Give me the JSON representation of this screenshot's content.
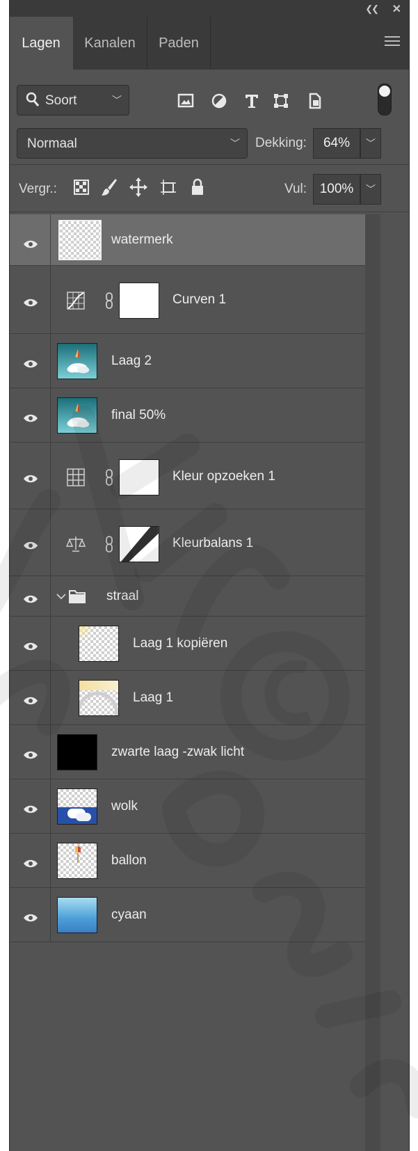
{
  "panel": {
    "tabs": [
      {
        "label": "Lagen",
        "active": true
      },
      {
        "label": "Kanalen",
        "active": false
      },
      {
        "label": "Paden",
        "active": false
      }
    ],
    "filter": {
      "label": "Soort"
    },
    "blend_mode": "Normaal",
    "opacity_label": "Dekking:",
    "opacity_value": "64%",
    "lock_label": "Vergr.:",
    "fill_label": "Vul:",
    "fill_value": "100%"
  },
  "layers": [
    {
      "name": "watermerk",
      "kind": "pixel",
      "selected": true
    },
    {
      "name": "Curven 1",
      "kind": "adjustment",
      "adjustment_icon": "curves-icon"
    },
    {
      "name": "Laag 2",
      "kind": "pixel"
    },
    {
      "name": "final  50%",
      "kind": "pixel"
    },
    {
      "name": "Kleur opzoeken 1",
      "kind": "adjustment",
      "adjustment_icon": "color-lookup-icon"
    },
    {
      "name": "Kleurbalans 1",
      "kind": "adjustment",
      "adjustment_icon": "color-balance-icon"
    },
    {
      "name": "straal",
      "kind": "group",
      "expanded": true
    },
    {
      "name": "Laag 1 kopiëren",
      "kind": "pixel",
      "in_group": true
    },
    {
      "name": "Laag 1",
      "kind": "pixel",
      "in_group": true
    },
    {
      "name": "zwarte laag -zwak licht",
      "kind": "pixel"
    },
    {
      "name": "wolk",
      "kind": "pixel"
    },
    {
      "name": "ballon",
      "kind": "pixel"
    },
    {
      "name": "cyaan",
      "kind": "pixel"
    }
  ],
  "colors": {
    "panel_bg": "#535353",
    "header_bg": "#3a3a3a",
    "selected_row": "#6d6d6d",
    "text": "#ededed"
  }
}
